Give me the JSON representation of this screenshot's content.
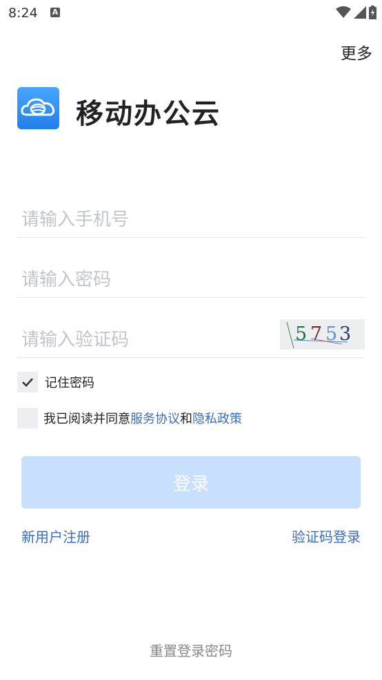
{
  "status_bar": {
    "time": "8:24",
    "app_icon_letter": "A",
    "icons": [
      "wifi-icon",
      "signal-icon",
      "battery-icon"
    ]
  },
  "header": {
    "more_label": "更多"
  },
  "app": {
    "name": "移动办公云",
    "brand_color": "#2d8ff5"
  },
  "form": {
    "phone_placeholder": "请输入手机号",
    "password_placeholder": "请输入密码",
    "captcha_placeholder": "请输入验证码",
    "captcha_digits": [
      {
        "char": "5",
        "color": "#2f6a4a"
      },
      {
        "char": "7",
        "color": "#6a2d3a"
      },
      {
        "char": "5",
        "color": "#5b8fd6"
      },
      {
        "char": "3",
        "color": "#2a3a6a"
      }
    ]
  },
  "remember_password": {
    "label": "记住密码",
    "checked": true
  },
  "agreement": {
    "prefix": "我已阅读并同意",
    "service_link": "服务协议",
    "conjunction": "和",
    "privacy_link": "隐私政策",
    "checked": false
  },
  "login_button": {
    "label": "登录",
    "color": "#c8dffd"
  },
  "links": {
    "register": "新用户注册",
    "sms_login": "验证码登录",
    "reset_password": "重置登录密码",
    "link_color": "#3a6cc8"
  }
}
